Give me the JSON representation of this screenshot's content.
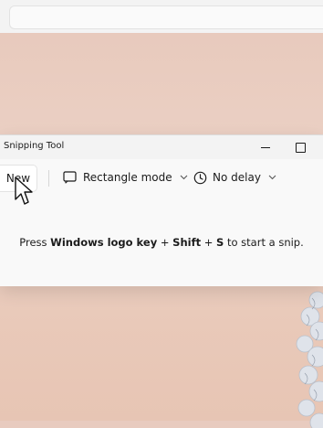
{
  "window": {
    "title": "Snipping Tool"
  },
  "toolbar": {
    "new_label": "New",
    "mode_label": "Rectangle mode",
    "delay_label": "No delay"
  },
  "message": {
    "prefix": "Press ",
    "key1": "Windows logo key",
    "plus1": " + ",
    "key2": "Shift",
    "plus2": " + ",
    "key3": "S",
    "suffix": " to start a snip."
  },
  "icons": {
    "mode": "rectangle-snip-icon",
    "delay": "clock-icon",
    "chevron": "chevron-down-icon"
  }
}
